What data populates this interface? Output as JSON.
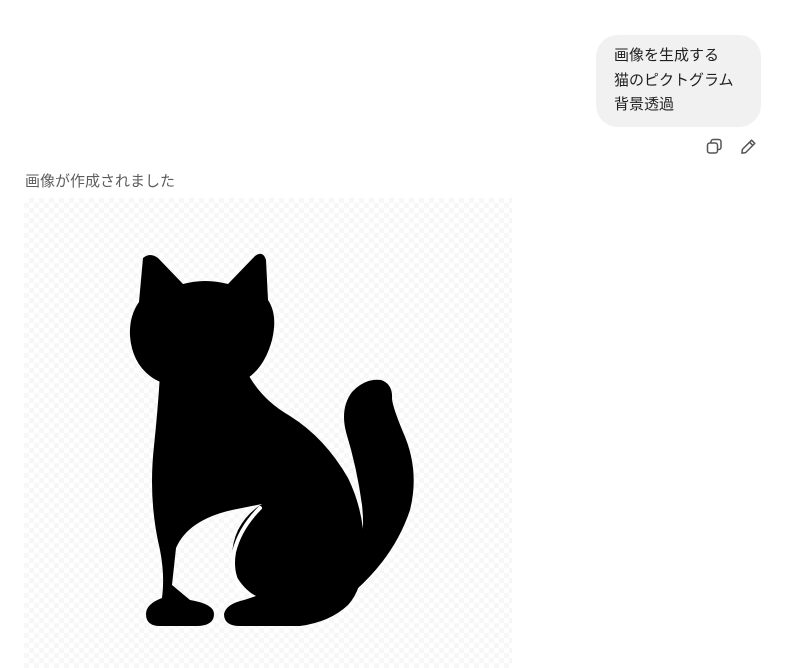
{
  "user_message": {
    "lines": [
      "画像を生成する",
      "猫のピクトグラム",
      "背景透過"
    ]
  },
  "message_actions": [
    {
      "name": "copy-button",
      "icon": "copy-icon"
    },
    {
      "name": "edit-button",
      "icon": "pencil-icon"
    }
  ],
  "assistant": {
    "status": "画像が作成されました",
    "image_subject": "cat pictogram silhouette on transparent background"
  },
  "colors": {
    "bubble_bg": "#f1f1f1",
    "silhouette": "#000000",
    "status_text": "#5d5d5d",
    "icon": "#555555"
  }
}
